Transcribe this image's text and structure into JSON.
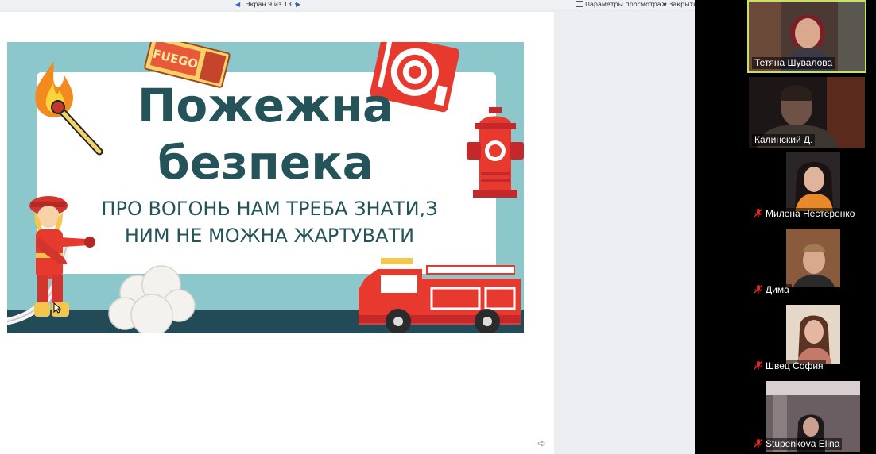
{
  "toolbar": {
    "prev_icon": "chevron-left-icon",
    "next_icon": "chevron-right-icon",
    "screen_counter": "Экран 9 из 13",
    "view_options": "Параметры просмотра",
    "close_label": "Закрыть"
  },
  "slide": {
    "title": "Пожежна\nбезпека",
    "subtitle": "ПРО ВОГОНЬ НАМ ТРЕБА ЗНАТИ,З\nНИМ НЕ МОЖНА ЖАРТУВАТИ",
    "matchbox_label": "FUEGO",
    "illustrations": [
      "burning-match-icon",
      "matchbox-icon",
      "fire-hose-reel-icon",
      "fire-hydrant-icon",
      "firefighter-icon",
      "smoke-cloud-icon",
      "fire-truck-icon"
    ]
  },
  "participants": [
    {
      "name": "Тетяна Шувалова",
      "muted": false,
      "active": true
    },
    {
      "name": "Калинский Д.",
      "muted": false,
      "active": false
    },
    {
      "name": "Милена Нестеренко",
      "muted": true,
      "active": false
    },
    {
      "name": "Дима",
      "muted": true,
      "active": false
    },
    {
      "name": "Швец София",
      "muted": true,
      "active": false
    },
    {
      "name": "Stupenkova Elina",
      "muted": true,
      "active": false
    }
  ],
  "colors": {
    "slide_teal": "#8cc7cb",
    "title_dark_teal": "#24545a",
    "fire_red": "#e8392f",
    "active_speaker": "#c6e25f",
    "mic_muted": "#e02828"
  }
}
